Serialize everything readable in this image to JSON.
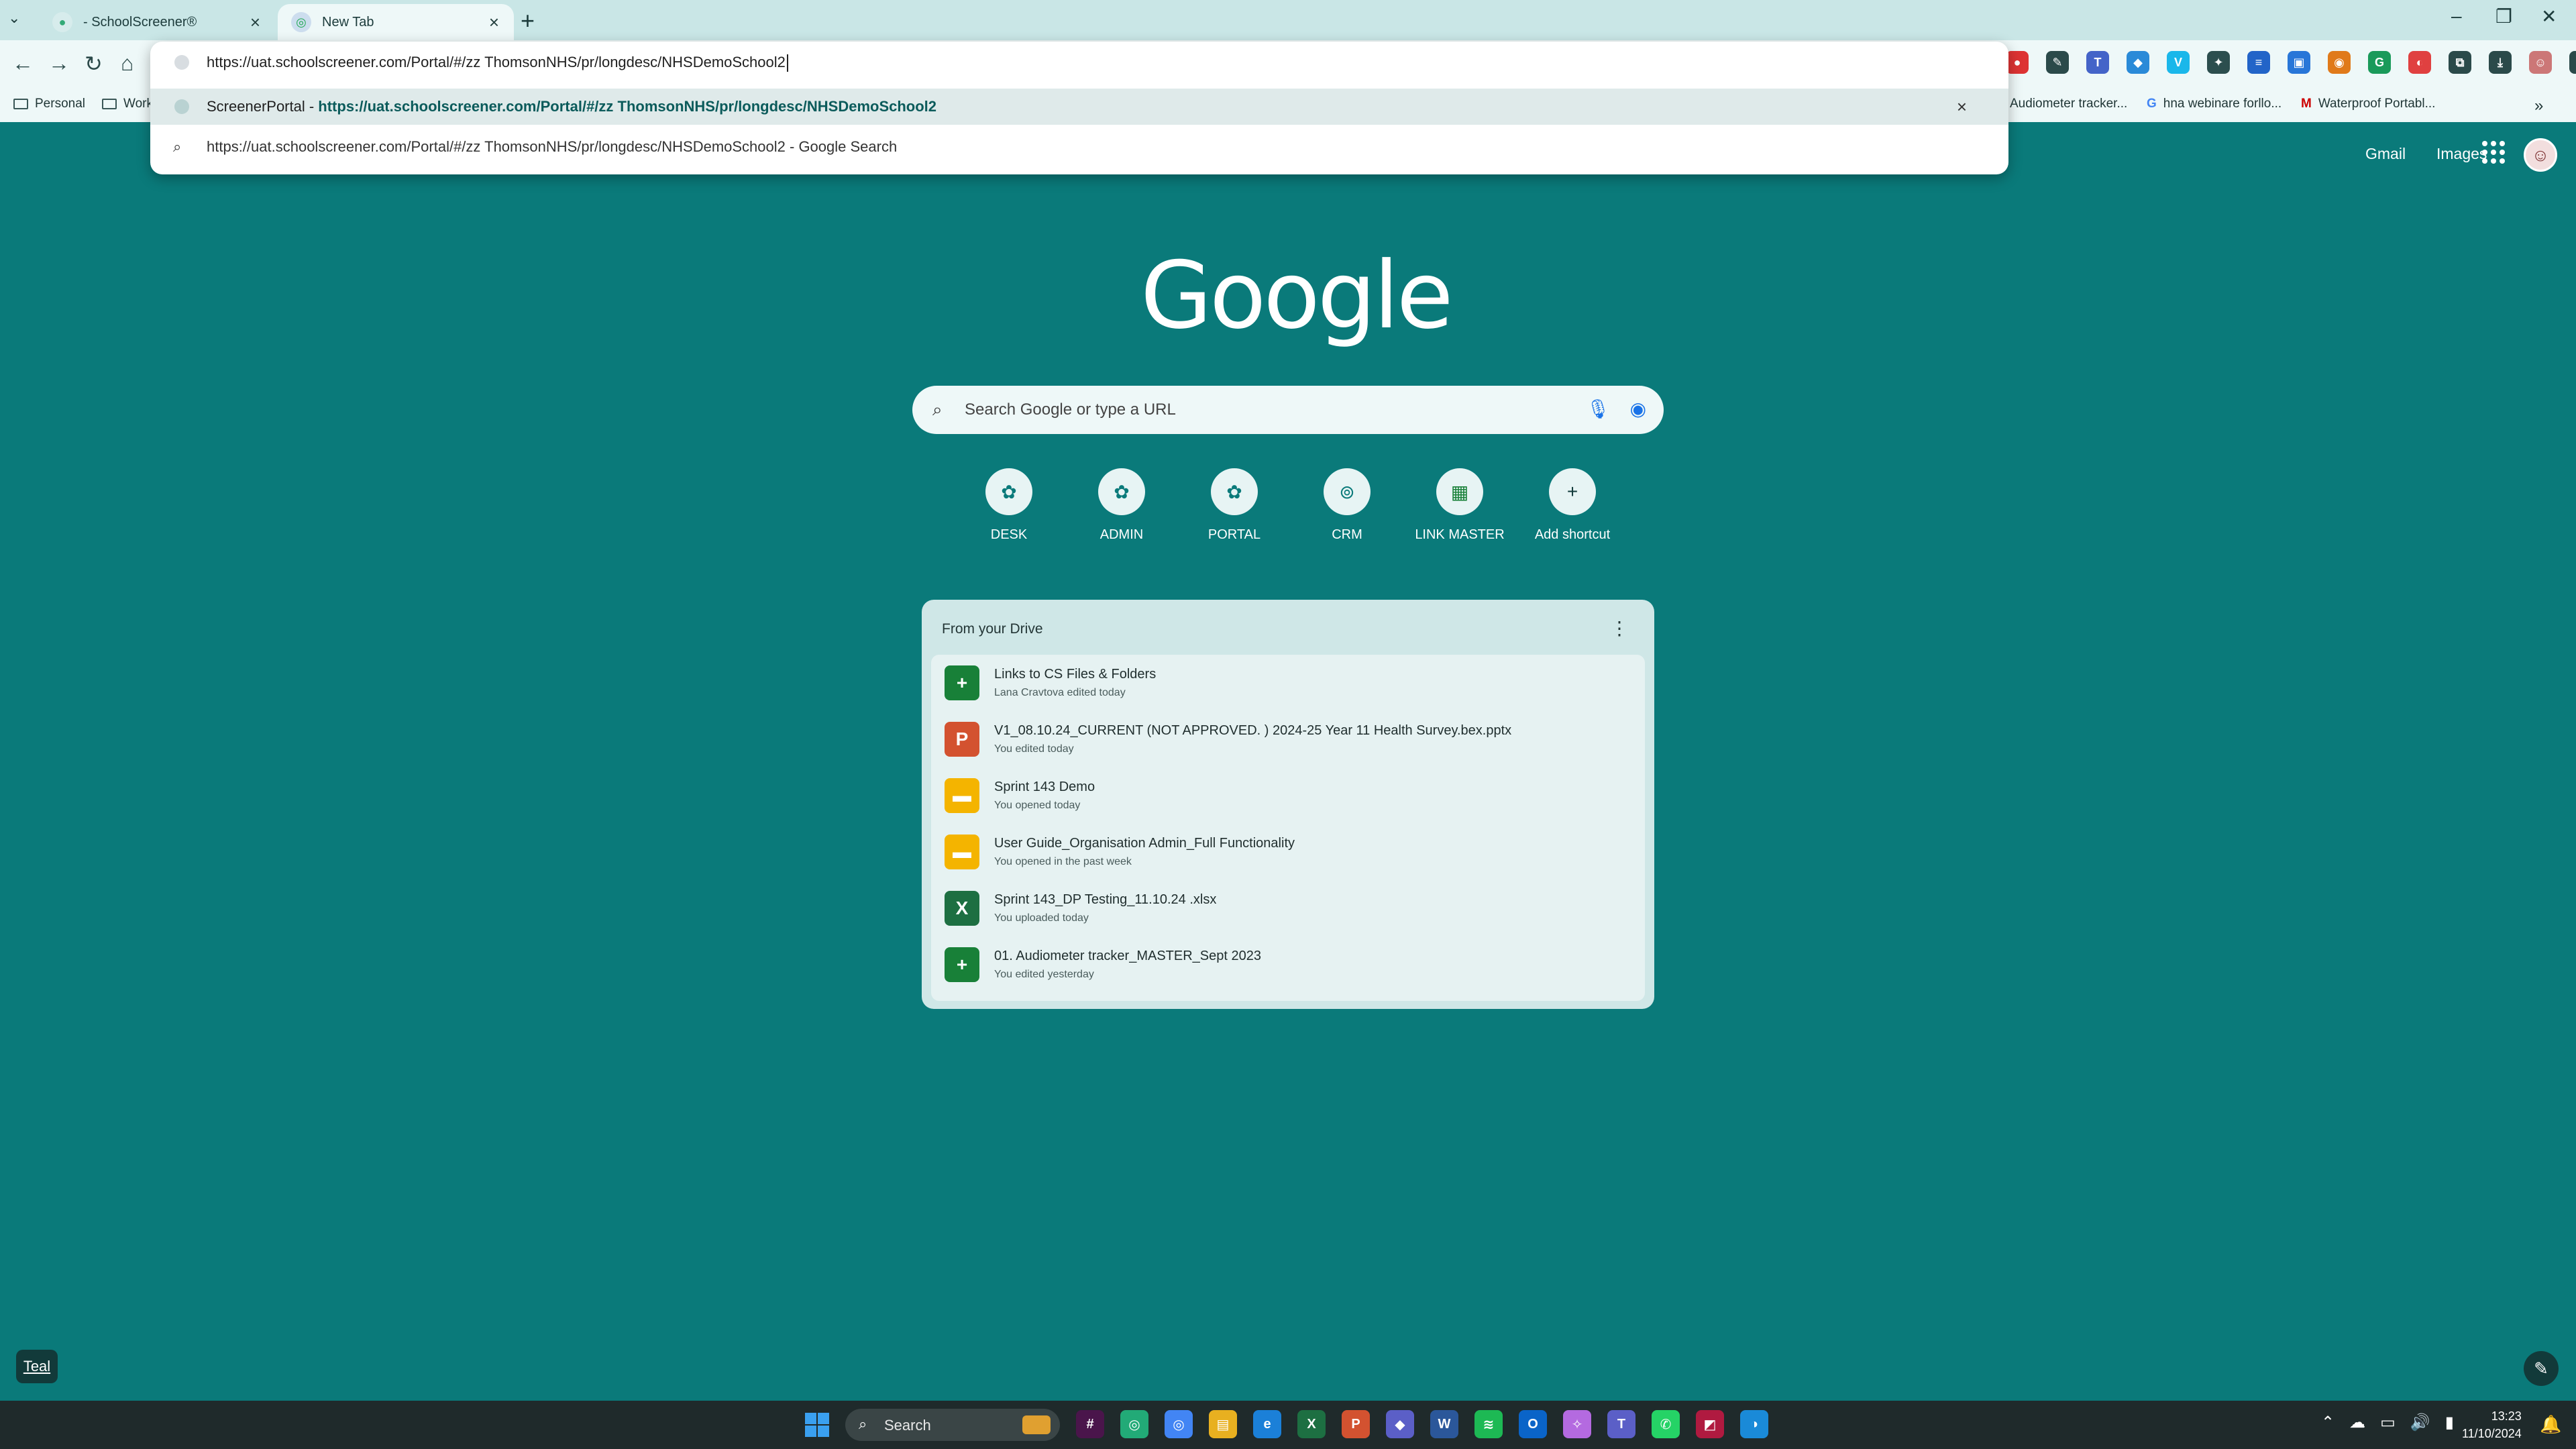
{
  "tabs": [
    {
      "title": "- SchoolScreener®"
    },
    {
      "title": "New Tab"
    }
  ],
  "omnibox": {
    "input": "https://uat.schoolscreener.com/Portal/#/zz ThomsonNHS/pr/longdesc/NHSDemoSchool2",
    "suggestions": [
      {
        "site": "ScreenerPortal - ",
        "url": "https://uat.schoolscreener.com/Portal/#/zz ThomsonNHS/pr/longdesc/NHSDemoSchool2"
      },
      {
        "text": "https://uat.schoolscreener.com/Portal/#/zz ThomsonNHS/pr/longdesc/NHSDemoSchool2 - Google Search"
      }
    ]
  },
  "bookmarks": [
    {
      "label": "Personal"
    },
    {
      "label": "Work"
    },
    {
      "label": "Audiometer tracker..."
    },
    {
      "label": "hna webinare forllo..."
    },
    {
      "label": "Waterproof Portabl..."
    }
  ],
  "header": {
    "gmail": "Gmail",
    "images": "Images"
  },
  "logo": "Google",
  "search": {
    "placeholder": "Search Google or type a URL"
  },
  "shortcuts": [
    {
      "label": "DESK"
    },
    {
      "label": "ADMIN"
    },
    {
      "label": "PORTAL"
    },
    {
      "label": "CRM"
    },
    {
      "label": "LINK MASTER"
    },
    {
      "label": "Add shortcut"
    }
  ],
  "drive": {
    "title": "From your Drive",
    "items": [
      {
        "name": "Links to CS Files & Folders",
        "detail": "Lana Cravtova edited today",
        "type": "sheets",
        "letter": "+",
        "color": "#188038"
      },
      {
        "name": "V1_08.10.24_CURRENT (NOT APPROVED. ) 2024-25 Year 11 Health Survey.bex.pptx",
        "detail": "You edited today",
        "type": "pptx",
        "letter": "P",
        "color": "#d35230"
      },
      {
        "name": "Sprint 143 Demo",
        "detail": "You opened today",
        "type": "slides",
        "letter": "▬",
        "color": "#f4b400"
      },
      {
        "name": "User Guide_Organisation Admin_Full Functionality",
        "detail": "You opened in the past week",
        "type": "slides",
        "letter": "▬",
        "color": "#f4b400"
      },
      {
        "name": "Sprint 143_DP Testing_11.10.24 .xlsx",
        "detail": "You uploaded today",
        "type": "xlsx",
        "letter": "X",
        "color": "#1d6f42"
      },
      {
        "name": "01. Audiometer tracker_MASTER_Sept 2023",
        "detail": "You edited yesterday",
        "type": "sheets",
        "letter": "+",
        "color": "#188038"
      }
    ]
  },
  "theme": {
    "label": "Teal",
    "accent": "#0a7a7a"
  },
  "taskbar": {
    "search_label": "Search",
    "time": "13:23",
    "date": "11/10/2024"
  }
}
